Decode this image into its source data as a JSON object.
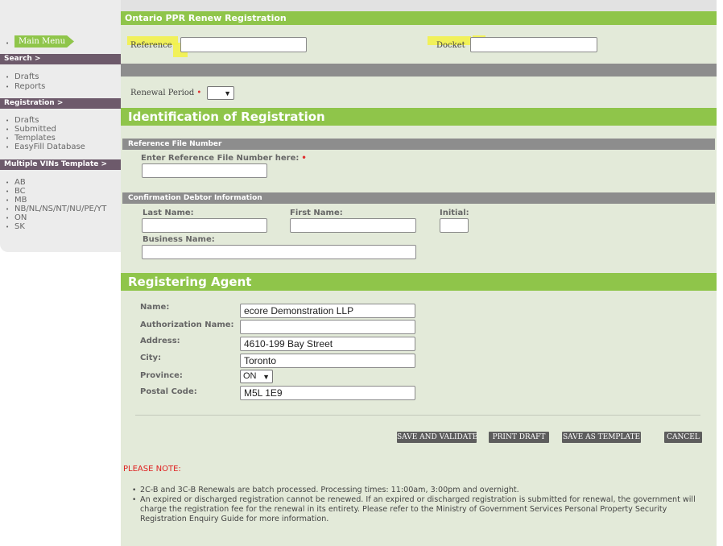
{
  "sidebar": {
    "main_menu": "Main Menu",
    "search_header": "Search >",
    "search_items": [
      "Drafts",
      "Reports"
    ],
    "registration_header": "Registration >",
    "registration_items": [
      "Drafts",
      "Submitted",
      "Templates",
      "EasyFill Database"
    ],
    "vins_header": "Multiple VINs Template >",
    "vins_items": [
      "AB",
      "BC",
      "MB",
      "NB/NL/NS/NT/NU/PE/YT",
      "ON",
      "SK"
    ]
  },
  "form": {
    "title": "Ontario PPR Renew Registration",
    "reference_label": "Reference",
    "reference_value": "",
    "docket_label": "Docket",
    "docket_value": "",
    "renewal_period_label": "Renewal Period",
    "renewal_period_value": "",
    "required_mark": "•"
  },
  "identification": {
    "heading": "Identification of Registration",
    "ref_file_bar": "Reference File Number",
    "ref_file_label": "Enter Reference File Number here:",
    "ref_file_value": "",
    "debtor_bar": "Confirmation Debtor Information",
    "last_name_label": "Last Name:",
    "first_name_label": "First Name:",
    "initial_label": "Initial:",
    "business_name_label": "Business Name:",
    "last_name_value": "",
    "first_name_value": "",
    "initial_value": "",
    "business_name_value": ""
  },
  "agent": {
    "heading": "Registering Agent",
    "name_label": "Name:",
    "name_value": "ecore Demonstration LLP",
    "auth_label": "Authorization Name:",
    "auth_value": "",
    "address_label": "Address:",
    "address_value": "4610-199 Bay Street",
    "city_label": "City:",
    "city_value": "Toronto",
    "province_label": "Province:",
    "province_value": "ON",
    "postal_label": "Postal Code:",
    "postal_value": "M5L 1E9"
  },
  "actions": {
    "save_validate": "SAVE AND VALIDATE",
    "print_draft": "PRINT DRAFT",
    "save_template": "SAVE AS TEMPLATE",
    "cancel": "CANCEL"
  },
  "notes": {
    "title": "PLEASE NOTE:",
    "items": [
      "2C-B and 3C-B Renewals are batch processed. Processing times: 11:00am, 3:00pm and overnight.",
      "An expired or discharged registration cannot be renewed. If an expired or discharged registration is submitted for renewal, the government will charge the registration fee for the renewal in its entirety. Please refer to the Ministry of Government Services Personal Property Security Registration Enquiry Guide for more information."
    ]
  },
  "colors": {
    "accent_green": "#8fc54a",
    "sidebar_header": "#6d5a6b",
    "panel_bg": "#e3ead9",
    "highlight_yellow": "#f2f24a",
    "note_red": "#e02020"
  },
  "icons": {
    "dropdown": "chevron-down-icon"
  }
}
